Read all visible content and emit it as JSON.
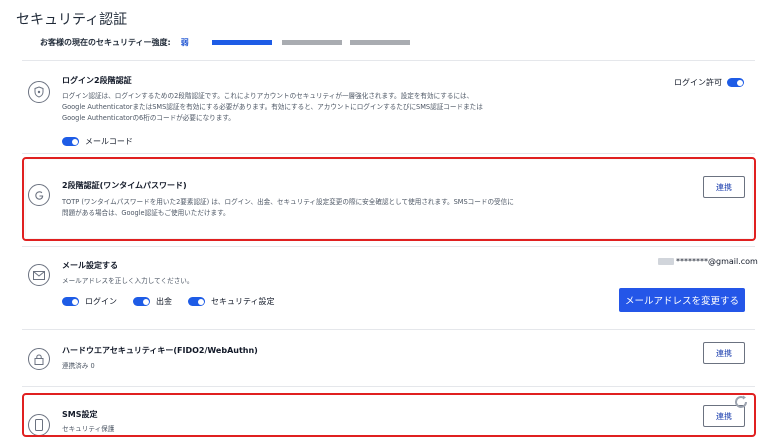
{
  "page": {
    "title": "セキュリティ認証"
  },
  "strength": {
    "label": "お客様の現在のセキュリティー強度:",
    "value": "弱",
    "level": 1,
    "total": 3
  },
  "sections": {
    "login2fa": {
      "title": "ログイン2段階認証",
      "desc": "ログイン認証は、ログインするための2段階認証です。これによりアカウントのセキュリティが一層強化されます。設定を有効にするには、\nGoogle AuthenticatorまたはSMS認証を有効にする必要があります。有効にすると、アカウントにログインするたびにSMS認証コードまたは\nGoogle Authenticatorの6桁のコードが必要になります。",
      "toggle_label": "メールコード",
      "allow_label": "ログイン許可"
    },
    "totp": {
      "title": "2段階認証(ワンタイムパスワード)",
      "desc": "TOTP (ワンタイムパスワードを用いた2要素認証) は、ログイン、出金、セキュリティ設定変更の際に安全確認として使用されます。SMSコードの受信に\n問題がある場合は、Google認証もご使用いただけます。",
      "button": "連携"
    },
    "email": {
      "title": "メール設定する",
      "desc": "メールアドレスを正しく入力してください。",
      "masked": "********@gmail.com",
      "toggles": [
        "ログイン",
        "出金",
        "セキュリティ設定"
      ],
      "button": "メールアドレスを変更する"
    },
    "hardware": {
      "title": "ハードウエアセキュリティキー(FIDO2/WebAuthn)",
      "desc": "連携済み 0",
      "button": "連携"
    },
    "sms": {
      "title": "SMS設定",
      "desc": "セキュリティ保護",
      "button": "連携"
    }
  },
  "colors": {
    "accent": "#1e5ce6",
    "highlight": "#e02020",
    "inactive_bar": "#a9acb1"
  }
}
